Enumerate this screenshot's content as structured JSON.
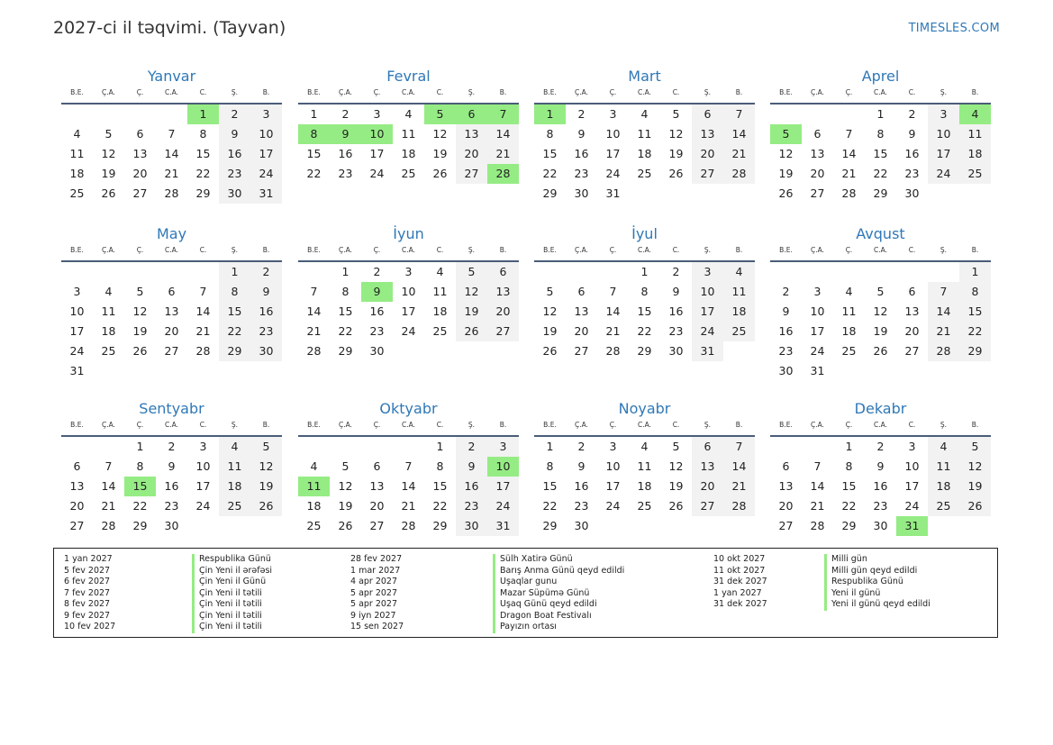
{
  "title": "2027-ci il təqvimi. (Tayvan)",
  "site": "TIMESLES.COM",
  "weekdays": [
    "B.E.",
    "Ç.A.",
    "Ç.",
    "C.A.",
    "C.",
    "Ş.",
    "B."
  ],
  "colors": {
    "holiday": "#95ec84",
    "weekend": "#f2f2f2",
    "accent": "#2f78b7"
  },
  "months": [
    {
      "name": "Yanvar",
      "offset": 4,
      "days": 31,
      "holidays": [
        1
      ]
    },
    {
      "name": "Fevral",
      "offset": 0,
      "days": 28,
      "holidays": [
        5,
        6,
        7,
        8,
        9,
        10,
        28
      ]
    },
    {
      "name": "Mart",
      "offset": 0,
      "days": 31,
      "holidays": [
        1
      ]
    },
    {
      "name": "Aprel",
      "offset": 3,
      "days": 30,
      "holidays": [
        4,
        5
      ]
    },
    {
      "name": "May",
      "offset": 5,
      "days": 31,
      "holidays": []
    },
    {
      "name": "İyun",
      "offset": 1,
      "days": 30,
      "holidays": [
        9
      ]
    },
    {
      "name": "İyul",
      "offset": 3,
      "days": 31,
      "holidays": []
    },
    {
      "name": "Avqust",
      "offset": 6,
      "days": 31,
      "holidays": []
    },
    {
      "name": "Sentyabr",
      "offset": 2,
      "days": 30,
      "holidays": [
        15
      ]
    },
    {
      "name": "Oktyabr",
      "offset": 4,
      "days": 31,
      "holidays": [
        10,
        11
      ]
    },
    {
      "name": "Noyabr",
      "offset": 0,
      "days": 30,
      "holidays": []
    },
    {
      "name": "Dekabr",
      "offset": 2,
      "days": 31,
      "holidays": [
        31
      ]
    }
  ],
  "legend": {
    "dates1": [
      "1 yan 2027",
      "5 fev 2027",
      "6 fev 2027",
      "7 fev 2027",
      "8 fev 2027",
      "9 fev 2027",
      "10 fev 2027"
    ],
    "names1": [
      "Respublika Günü",
      "Çin Yeni il ərəfəsi",
      "Çin Yeni il Günü",
      "Çin Yeni il tətili",
      "Çin Yeni il tətili",
      "Çin Yeni il tətili",
      "Çin Yeni il tətili"
    ],
    "dates2": [
      "28 fev 2027",
      "1 mar 2027",
      "4 apr 2027",
      "5 apr 2027",
      "5 apr 2027",
      "9 iyn 2027",
      "15 sen 2027"
    ],
    "names2": [
      "Sülh Xatirə Günü",
      "Barış Anma Günü qeyd edildi",
      "Uşaqlar gunu",
      "Mazar Süpümə Günü",
      "Uşaq Günü qeyd edildi",
      "Dragon Boat Festivalı",
      "Payızın ortası"
    ],
    "dates3": [
      "10 okt 2027",
      "11 okt 2027",
      "31 dek 2027",
      "1 yan 2027",
      "31 dek 2027"
    ],
    "names3": [
      "Milli gün",
      "Milli gün qeyd edildi",
      "Respublika Günü",
      "Yeni il günü",
      "Yeni il günü qeyd edildi"
    ]
  }
}
